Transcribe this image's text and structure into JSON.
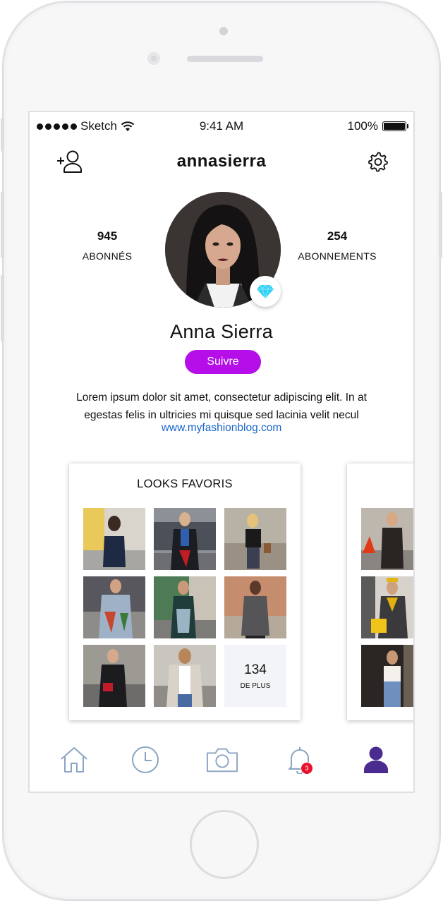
{
  "status_bar": {
    "carrier": "Sketch",
    "time": "9:41 AM",
    "battery": "100%",
    "icons": [
      "signal-dots-icon",
      "wifi-icon",
      "battery-icon"
    ]
  },
  "header": {
    "username": "annasierra",
    "left_icon": "add-user-icon",
    "right_icon": "gear-icon"
  },
  "profile": {
    "followers": {
      "count": "945",
      "label": "ABONNÉS"
    },
    "following": {
      "count": "254",
      "label": "ABONNEMENTS"
    },
    "name": "Anna Sierra",
    "badge_icon": "diamond-icon",
    "follow_label": "Suivre",
    "bio": "Lorem ipsum dolor sit amet, consectetur adipiscing elit. In at egestas felis in ultricies mi quisque sed lacinia velit necul",
    "website": "www.myfashionblog.com"
  },
  "collections": [
    {
      "title": "LOOKS FAVORIS",
      "more_count": "134",
      "more_label": "DE PLUS"
    }
  ],
  "tab_bar": {
    "items": [
      {
        "name": "home",
        "icon": "home-icon"
      },
      {
        "name": "history",
        "icon": "clock-icon"
      },
      {
        "name": "camera",
        "icon": "camera-icon"
      },
      {
        "name": "notifications",
        "icon": "bell-icon",
        "badge": "3"
      },
      {
        "name": "profile",
        "icon": "user-icon",
        "active": true
      }
    ]
  },
  "colors": {
    "accent": "#b50ee8",
    "link": "#1a66c9",
    "tab_inactive": "#8ba4c2",
    "tab_active": "#4a2b8f",
    "badge": "#e8112d"
  }
}
